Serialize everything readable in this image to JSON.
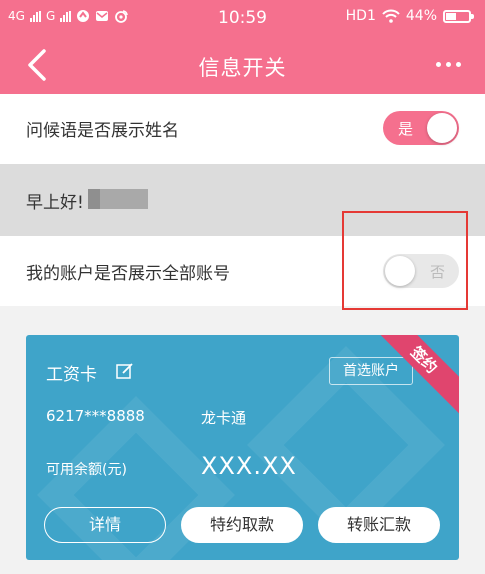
{
  "status_bar": {
    "net1": "4G",
    "net2": "G",
    "time": "10:59",
    "hd": "HD1",
    "battery": "44%",
    "battery_level": 0.44
  },
  "nav": {
    "title": "信息开关"
  },
  "settings": {
    "greeting_name": {
      "label": "问候语是否展示姓名",
      "toggle_text": "是",
      "enabled": true
    },
    "greeting_preview": "早上好!",
    "show_full_account": {
      "label": "我的账户是否展示全部账号",
      "toggle_text": "否",
      "enabled": false
    }
  },
  "card": {
    "title": "工资卡",
    "preferred_label": "首选账户",
    "ribbon": "签约",
    "account_number": "6217***8888",
    "account_type": "龙卡通",
    "balance_label": "可用余额(元)",
    "balance_value": "XXX.XX",
    "buttons": {
      "details": "详情",
      "special_withdraw": "特约取款",
      "transfer": "转账汇款"
    }
  },
  "colors": {
    "brand": "#f5708e",
    "card": "#3fa4c9",
    "ribbon": "#e0456e",
    "highlight": "#e53935"
  }
}
